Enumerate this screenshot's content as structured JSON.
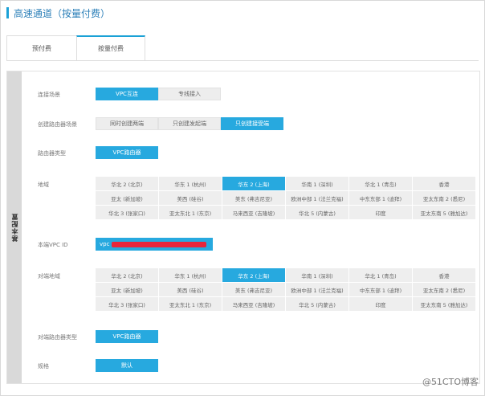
{
  "header": {
    "title": "高速通道（按量付费）"
  },
  "tabs": [
    {
      "label": "预付费",
      "active": false
    },
    {
      "label": "按量付费",
      "active": true
    }
  ],
  "side_label": "基本配置",
  "connection_scenario": {
    "label": "连接场景",
    "options": [
      {
        "label": "VPC互连",
        "selected": true
      },
      {
        "label": "专线接入",
        "selected": false
      }
    ]
  },
  "create_router_scenario": {
    "label": "创建路由器场景",
    "options": [
      {
        "label": "同时创建两端",
        "selected": false
      },
      {
        "label": "只创建发起端",
        "selected": false
      },
      {
        "label": "只创建接受端",
        "selected": true
      }
    ]
  },
  "router_type": {
    "label": "路由器类型",
    "value": "VPC路由器"
  },
  "region": {
    "label": "地域",
    "cells": [
      "华北 2 (北京)",
      "华东 1 (杭州)",
      "华东 2 (上海)",
      "华南 1 (深圳)",
      "华北 1 (青岛)",
      "香港",
      "亚太 (新加坡)",
      "美西 (硅谷)",
      "美东 (弗吉尼亚)",
      "欧洲中部 1 (法兰克福)",
      "中东东部 1 (迪拜)",
      "亚太东南 2 (悉尼)",
      "华北 3 (张家口)",
      "亚太东北 1 (东京)",
      "马来西亚 (吉隆坡)",
      "华北 5 (内蒙古)",
      "印度",
      "亚太东南 5 (雅加达)"
    ],
    "selected": "华东 2 (上海)"
  },
  "local_vpc_id": {
    "label": "本端VPC ID",
    "value": "vpc"
  },
  "peer_region": {
    "label": "对端地域",
    "cells": [
      "华北 2 (北京)",
      "华东 1 (杭州)",
      "华东 2 (上海)",
      "华南 1 (深圳)",
      "华北 1 (青岛)",
      "香港",
      "亚太 (新加坡)",
      "美西 (硅谷)",
      "美东 (弗吉尼亚)",
      "欧洲中部 1 (法兰克福)",
      "中东东部 1 (迪拜)",
      "亚太东南 2 (悉尼)",
      "华北 3 (张家口)",
      "亚太东北 1 (东京)",
      "马来西亚 (吉隆坡)",
      "华北 5 (内蒙古)",
      "印度",
      "亚太东南 5 (雅加达)"
    ],
    "selected": "华东 2 (上海)"
  },
  "peer_router_type": {
    "label": "对端路由器类型",
    "value": "VPC路由器"
  },
  "spec": {
    "label": "规格",
    "value": "默认"
  },
  "watermark": "@51CTO博客",
  "colors": {
    "accent": "#27a9df",
    "title": "#2b7fb8",
    "redaction": "#e8253a"
  }
}
